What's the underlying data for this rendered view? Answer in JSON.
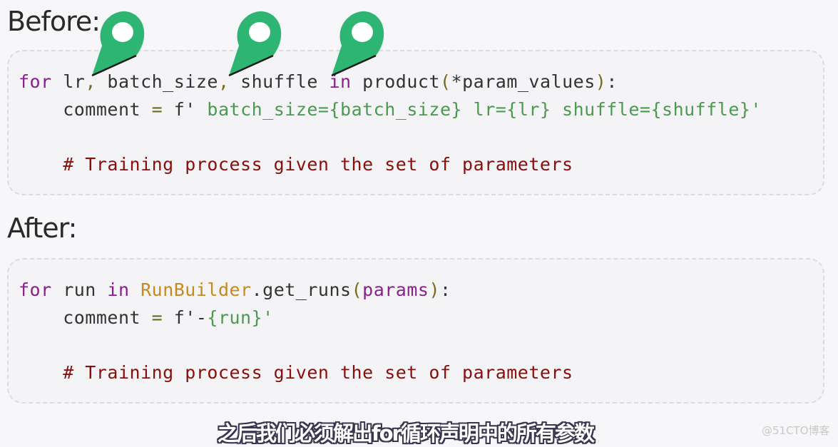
{
  "before": {
    "heading": "Before:",
    "lines": [
      [
        {
          "t": "for",
          "c": "kw"
        },
        {
          "t": " lr",
          "c": ""
        },
        {
          "t": ",",
          "c": "punc"
        },
        {
          "t": " batch_size",
          "c": ""
        },
        {
          "t": ",",
          "c": "punc"
        },
        {
          "t": " shuffle ",
          "c": ""
        },
        {
          "t": "in",
          "c": "kw"
        },
        {
          "t": " product",
          "c": ""
        },
        {
          "t": "(",
          "c": "punc"
        },
        {
          "t": "*param_values",
          "c": ""
        },
        {
          "t": ")",
          "c": "punc"
        },
        {
          "t": ":",
          "c": ""
        }
      ],
      [
        {
          "t": "    comment ",
          "c": ""
        },
        {
          "t": "=",
          "c": "op"
        },
        {
          "t": " f",
          "c": ""
        },
        {
          "t": "'",
          "c": ""
        },
        {
          "t": " batch_size={batch_size} lr={lr} shuffle={shuffle}'",
          "c": "str"
        }
      ],
      [],
      [
        {
          "t": "    # Training process given the set of parameters",
          "c": "cmt"
        }
      ]
    ]
  },
  "after": {
    "heading": "After:",
    "lines": [
      [
        {
          "t": "for",
          "c": "kw"
        },
        {
          "t": " run ",
          "c": ""
        },
        {
          "t": "in",
          "c": "kw"
        },
        {
          "t": " ",
          "c": ""
        },
        {
          "t": "RunBuilder",
          "c": "cls"
        },
        {
          "t": ".get_runs",
          "c": ""
        },
        {
          "t": "(",
          "c": "punc"
        },
        {
          "t": "params",
          "c": "kw"
        },
        {
          "t": ")",
          "c": "punc"
        },
        {
          "t": ":",
          "c": ""
        }
      ],
      [
        {
          "t": "    comment ",
          "c": ""
        },
        {
          "t": "=",
          "c": "op"
        },
        {
          "t": " f",
          "c": ""
        },
        {
          "t": "'-",
          "c": ""
        },
        {
          "t": "{run}'",
          "c": "str"
        }
      ],
      [],
      [
        {
          "t": "    # Training process given the set of parameters",
          "c": "cmt"
        }
      ]
    ]
  },
  "pins": {
    "count": 3,
    "color": "#2db574",
    "targets": [
      "lr",
      "batch_size",
      "shuffle"
    ]
  },
  "subtitle": "之后我们必须解出for循环声明中的所有参数",
  "watermark": "@51CTO博客"
}
